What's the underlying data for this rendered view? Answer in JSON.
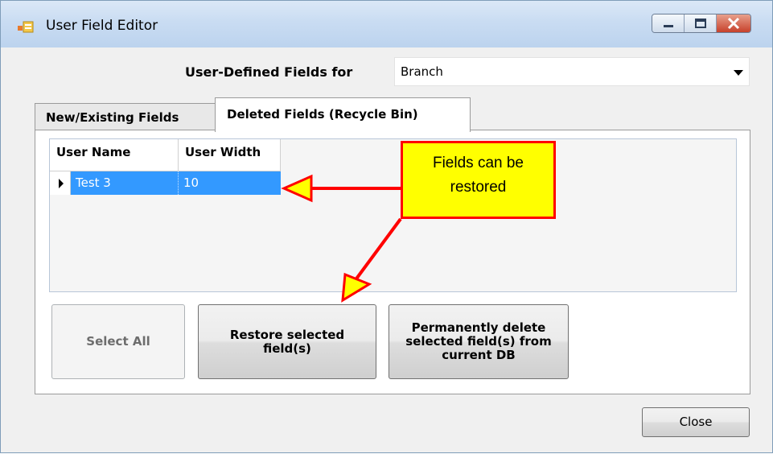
{
  "window": {
    "title": "User Field Editor"
  },
  "form": {
    "for_label": "User-Defined Fields for",
    "for_value": "Branch"
  },
  "tabs": [
    {
      "label": "New/Existing Fields",
      "selected": false
    },
    {
      "label": "Deleted Fields (Recycle Bin)",
      "selected": true
    }
  ],
  "grid": {
    "columns": [
      "User Name",
      "User Width"
    ],
    "rows": [
      {
        "name": "Test 3",
        "width": "10",
        "selected": true
      }
    ]
  },
  "buttons": {
    "select_all": "Select All",
    "restore": "Restore selected field(s)",
    "permanently_delete": "Permanently delete selected field(s) from current DB",
    "close": "Close"
  },
  "annotation": {
    "callout_text": "Fields can be restored",
    "fill_color": "#ffff00",
    "border_color": "#ff0000"
  },
  "colors": {
    "selection": "#3399ff",
    "titlebar": "#c9dcf2",
    "close_button": "#c7412b"
  }
}
